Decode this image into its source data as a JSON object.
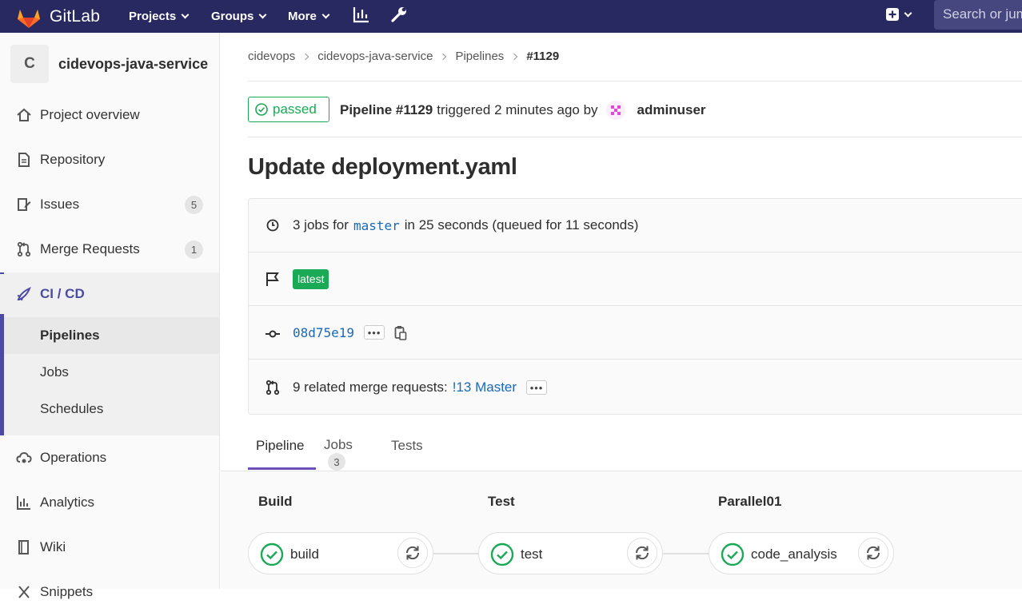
{
  "navbar": {
    "brand": "GitLab",
    "items": [
      {
        "label": "Projects"
      },
      {
        "label": "Groups"
      },
      {
        "label": "More"
      }
    ],
    "search_placeholder": "Search or jump to…"
  },
  "sidebar": {
    "project_initial": "C",
    "project_name": "cidevops-java-service",
    "items": {
      "overview": "Project overview",
      "repository": "Repository",
      "issues": "Issues",
      "issues_count": "5",
      "merge_requests": "Merge Requests",
      "mr_count": "1",
      "cicd": "CI / CD",
      "pipelines": "Pipelines",
      "jobs": "Jobs",
      "schedules": "Schedules",
      "operations": "Operations",
      "analytics": "Analytics",
      "wiki": "Wiki",
      "snippets": "Snippets"
    }
  },
  "breadcrumb": [
    "cidevops",
    "cidevops-java-service",
    "Pipelines",
    "#1129"
  ],
  "pipeline": {
    "status": "passed",
    "id_label": "Pipeline #1129",
    "triggered_text": "triggered 2 minutes ago by",
    "user": "adminuser",
    "title": "Update deployment.yaml",
    "jobs_prefix": "3 jobs for",
    "branch": "master",
    "jobs_suffix": "in 25 seconds (queued for 11 seconds)",
    "tag": "latest",
    "commit_sha": "08d75e19",
    "mr_text": "9 related merge requests:",
    "mr_link": "!13 Master"
  },
  "tabs": {
    "pipeline": "Pipeline",
    "jobs": "Jobs",
    "jobs_count": "3",
    "tests": "Tests"
  },
  "stages": [
    {
      "name": "Build",
      "job": "build"
    },
    {
      "name": "Test",
      "job": "test"
    },
    {
      "name": "Parallel01",
      "job": "code_analysis"
    }
  ],
  "colors": {
    "navbar": "#292961",
    "success": "#1aaa55",
    "link": "#1b69b6",
    "active_accent": "#4b4ba3"
  }
}
